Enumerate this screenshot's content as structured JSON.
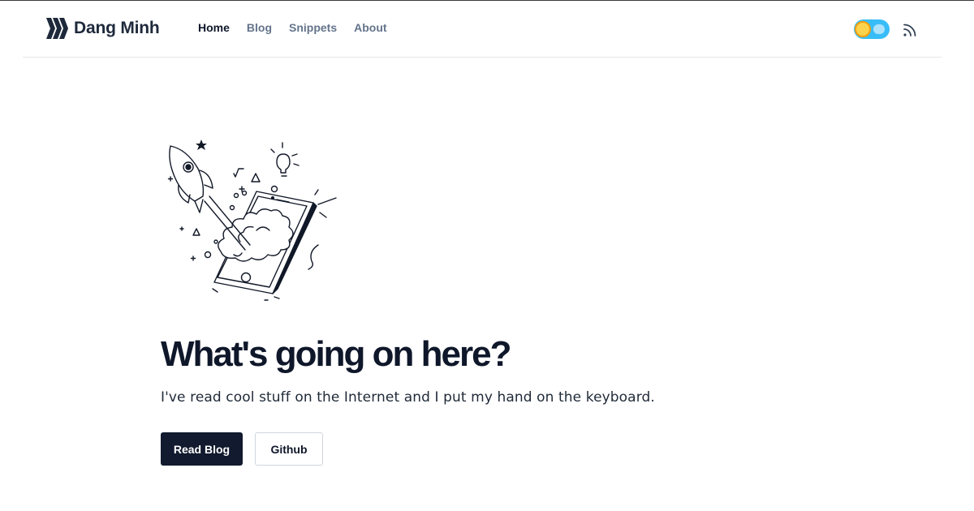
{
  "site": {
    "brand_name": "Dang Minh",
    "logo_icon": "triple-chevron-logo-icon"
  },
  "nav": {
    "items": [
      {
        "label": "Home",
        "active": true
      },
      {
        "label": "Blog",
        "active": false
      },
      {
        "label": "Snippets",
        "active": false
      },
      {
        "label": "About",
        "active": false
      }
    ]
  },
  "header_actions": {
    "theme_toggle_icon": "theme-toggle-sun-icon",
    "rss_icon": "rss-icon"
  },
  "hero": {
    "illustration": "rocket-launch-phone-icon",
    "title": "What's going on here?",
    "subtitle": "I've read cool stuff on the Internet and I put my hand on the keyboard.",
    "primary_button": "Read Blog",
    "secondary_button": "Github"
  },
  "colors": {
    "text_dark": "#0f172a",
    "nav_muted": "#64748b",
    "primary_button_bg": "#111a2e",
    "toggle_track": "#38bdf8",
    "toggle_knob": "#fcd34d"
  }
}
